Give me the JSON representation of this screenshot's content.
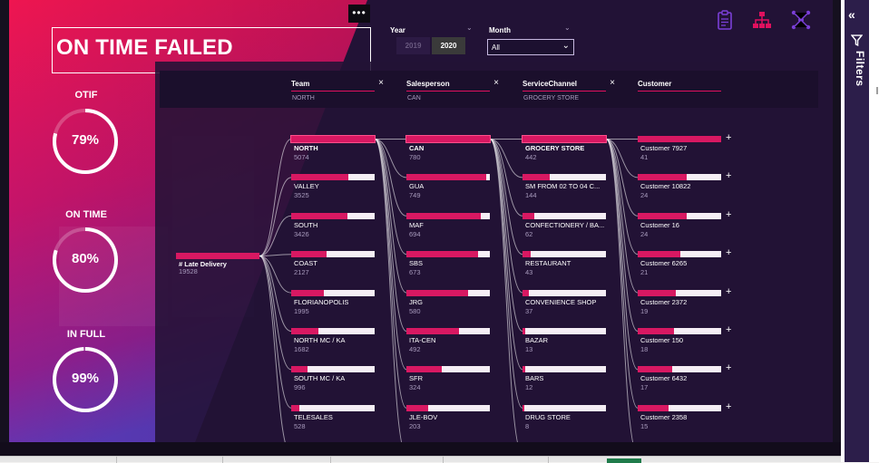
{
  "report": {
    "title": "ON TIME FAILED",
    "menu_glyph": "•••"
  },
  "kpis": [
    {
      "label": "OTIF",
      "value": "79%",
      "fraction": 0.79
    },
    {
      "label": "ON TIME",
      "value": "80%",
      "fraction": 0.8
    },
    {
      "label": "IN FULL",
      "value": "99%",
      "fraction": 0.99
    }
  ],
  "slicers": {
    "year_label": "Year",
    "years": [
      "2019",
      "2020"
    ],
    "selected_year": "2020",
    "month_label": "Month",
    "month_value": "All"
  },
  "nav_icons": [
    "clipboard-icon",
    "hierarchy-icon",
    "network-icon"
  ],
  "colors": {
    "accent": "#d81862",
    "panel": "#221236",
    "bar_bg": "#f5eef5",
    "muted_text": "#a89bbd"
  },
  "decomposition_tree": {
    "root": {
      "label": "# Late Delivery",
      "value": "19528",
      "fraction": 1.0
    },
    "levels": [
      {
        "field": "Team",
        "filter_value": "NORTH",
        "nodes": [
          {
            "label": "NORTH",
            "value": "5074",
            "fraction": 1.0,
            "selected": true
          },
          {
            "label": "VALLEY",
            "value": "3525",
            "fraction": 0.69
          },
          {
            "label": "SOUTH",
            "value": "3426",
            "fraction": 0.67
          },
          {
            "label": "COAST",
            "value": "2127",
            "fraction": 0.42
          },
          {
            "label": "FLORIANOPOLIS",
            "value": "1995",
            "fraction": 0.39
          },
          {
            "label": "NORTH MC / KA",
            "value": "1682",
            "fraction": 0.33
          },
          {
            "label": "SOUTH MC / KA",
            "value": "996",
            "fraction": 0.2
          },
          {
            "label": "TELESALES",
            "value": "528",
            "fraction": 0.1
          }
        ]
      },
      {
        "field": "Salesperson",
        "filter_value": "CAN",
        "nodes": [
          {
            "label": "CAN",
            "value": "780",
            "fraction": 1.0,
            "selected": true
          },
          {
            "label": "GUA",
            "value": "749",
            "fraction": 0.96
          },
          {
            "label": "MAF",
            "value": "694",
            "fraction": 0.89
          },
          {
            "label": "SBS",
            "value": "673",
            "fraction": 0.86
          },
          {
            "label": "JRG",
            "value": "580",
            "fraction": 0.74
          },
          {
            "label": "ITA-CEN",
            "value": "492",
            "fraction": 0.63
          },
          {
            "label": "SFR",
            "value": "324",
            "fraction": 0.42
          },
          {
            "label": "JLE-BOV",
            "value": "203",
            "fraction": 0.26
          }
        ]
      },
      {
        "field": "ServiceChannel",
        "filter_value": "GROCERY STORE",
        "nodes": [
          {
            "label": "GROCERY STORE",
            "value": "442",
            "fraction": 1.0,
            "selected": true
          },
          {
            "label": "SM FROM 02 TO 04 C...",
            "value": "144",
            "fraction": 0.33
          },
          {
            "label": "CONFECTIONERY / BA...",
            "value": "62",
            "fraction": 0.14
          },
          {
            "label": "RESTAURANT",
            "value": "43",
            "fraction": 0.1
          },
          {
            "label": "CONVENIENCE SHOP",
            "value": "37",
            "fraction": 0.08
          },
          {
            "label": "BAZAR",
            "value": "13",
            "fraction": 0.03
          },
          {
            "label": "BARS",
            "value": "12",
            "fraction": 0.03
          },
          {
            "label": "DRUG STORE",
            "value": "8",
            "fraction": 0.02
          }
        ]
      },
      {
        "field": "Customer",
        "filter_value": "",
        "nodes": [
          {
            "label": "Customer 7927",
            "value": "41",
            "fraction": 1.0
          },
          {
            "label": "Customer 10822",
            "value": "24",
            "fraction": 0.59
          },
          {
            "label": "Customer 16",
            "value": "24",
            "fraction": 0.59
          },
          {
            "label": "Customer 6265",
            "value": "21",
            "fraction": 0.51
          },
          {
            "label": "Customer 2372",
            "value": "19",
            "fraction": 0.46
          },
          {
            "label": "Customer 150",
            "value": "18",
            "fraction": 0.44
          },
          {
            "label": "Customer 6432",
            "value": "17",
            "fraction": 0.41
          },
          {
            "label": "Customer 2358",
            "value": "15",
            "fraction": 0.37
          }
        ]
      }
    ],
    "expand_glyph": "+",
    "remove_glyph": "×"
  },
  "filters_pane": {
    "label": "Filters",
    "collapse_glyph": "«"
  }
}
